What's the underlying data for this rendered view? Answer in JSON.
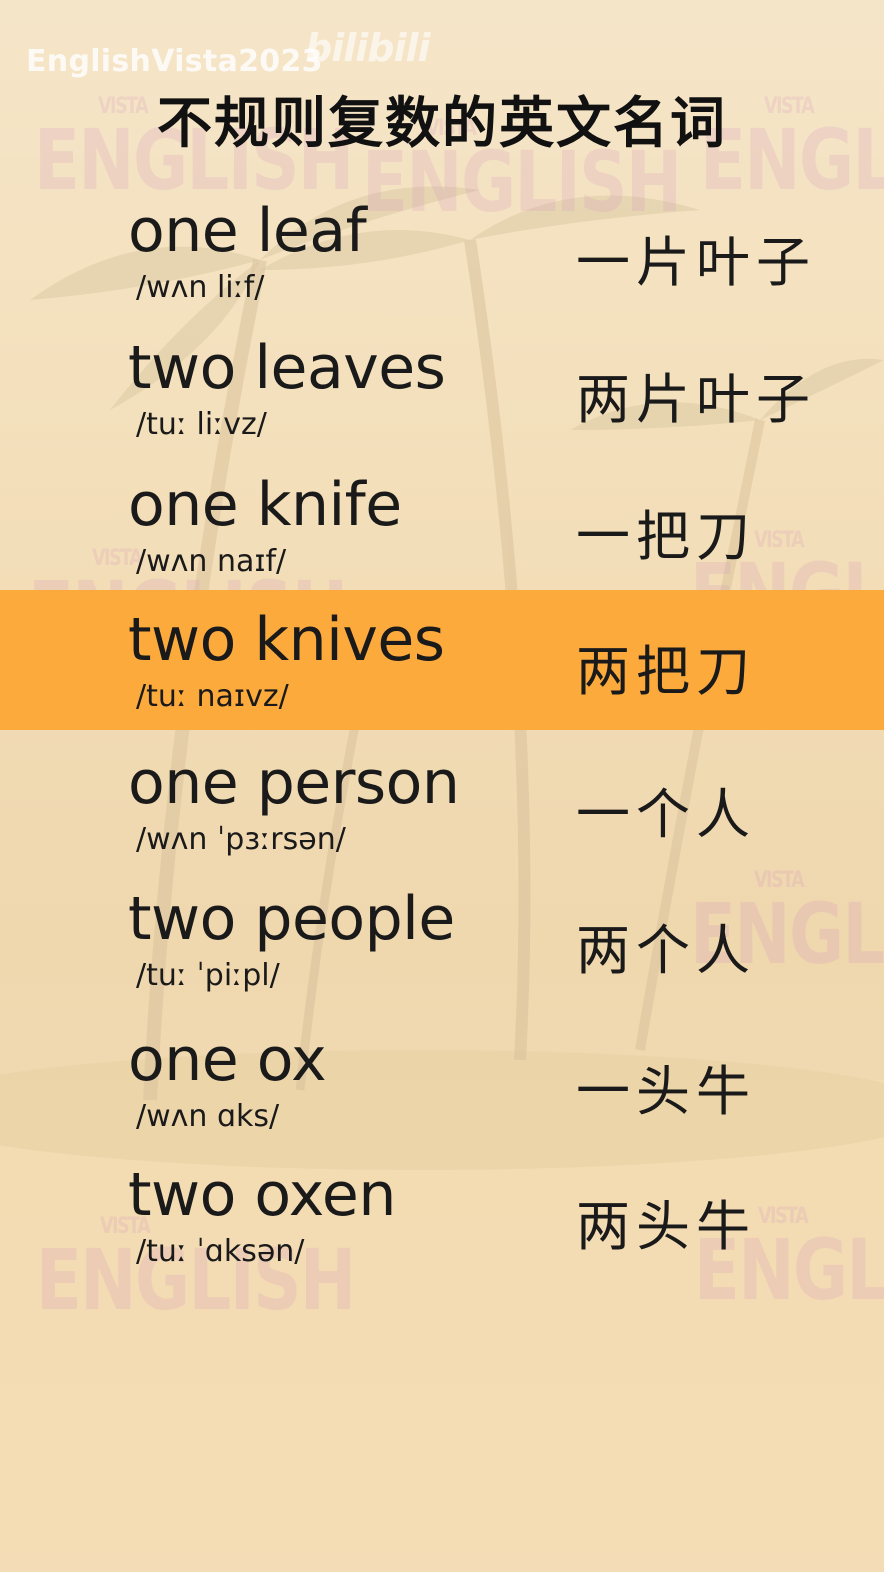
{
  "channel": "EnglishVista2023",
  "platform": "bilibili",
  "title": "不规则复数的英文名词",
  "watermark": {
    "small": "VISTA",
    "big": "ENGLISH"
  },
  "highlight_color": "#fdaa3d",
  "entries": [
    {
      "word": "one leaf",
      "ipa": "/wʌn liːf/",
      "zh": "一片叶子"
    },
    {
      "word": "two leaves",
      "ipa": "/tuː liːvz/",
      "zh": "两片叶子"
    },
    {
      "word": "one knife",
      "ipa": "/wʌn naɪf/",
      "zh": "一把刀"
    },
    {
      "word": "two knives",
      "ipa": "/tuː naɪvz/",
      "zh": "两把刀",
      "highlighted": true
    },
    {
      "word": "one person",
      "ipa": "/wʌn ˈpɜːrsən/",
      "zh": "一个人"
    },
    {
      "word": "two people",
      "ipa": "/tuː ˈpiːpl/",
      "zh": "两个人"
    },
    {
      "word": "one ox",
      "ipa": "/wʌn ɑks/",
      "zh": "一头牛"
    },
    {
      "word": "two oxen",
      "ipa": "/tuː ˈɑksən/",
      "zh": "两头牛"
    }
  ]
}
